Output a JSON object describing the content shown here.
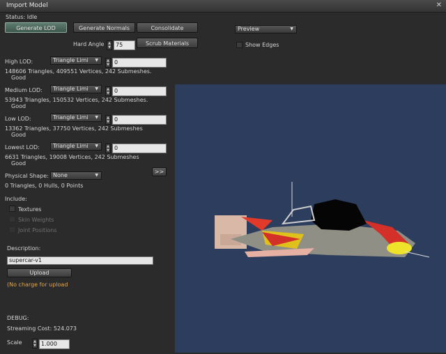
{
  "window": {
    "title": "Import Model",
    "close_label": "✕"
  },
  "status": "Status: Idle",
  "buttons": {
    "generate_lod": "Generate LOD",
    "generate_normals": "Generate Normals",
    "consolidate": "Consolidate",
    "scrub_materials": "Scrub Materials",
    "upload": "Upload",
    "expand": ">>"
  },
  "hard_angle": {
    "label": "Hard Angle",
    "value": "75"
  },
  "preview": {
    "selected": "Preview",
    "show_edges_label": "Show Edges"
  },
  "lods": [
    {
      "label": "High LOD:",
      "mode": "Triangle Limi",
      "value": "0",
      "stats": "148606 Triangles, 409551 Vertices, 242 Submeshes.",
      "quality": "Good"
    },
    {
      "label": "Medium LOD:",
      "mode": "Triangle Limi",
      "value": "0",
      "stats": "53943 Triangles, 150532 Vertices, 242 Submeshes.",
      "quality": "Good"
    },
    {
      "label": "Low LOD:",
      "mode": "Triangle Limi",
      "value": "0",
      "stats": "13362 Triangles, 37750 Vertices, 242 Submeshes",
      "quality": "Good"
    },
    {
      "label": "Lowest LOD:",
      "mode": "Triangle Limi",
      "value": "0",
      "stats": "6631 Triangles, 19008 Vertices, 242 Submeshes",
      "quality": "Good"
    }
  ],
  "physical": {
    "label": "Physical Shape:",
    "selected": "None",
    "stats": "0 Triangles, 0 Hulls, 0 Points"
  },
  "include": {
    "label": "Include:",
    "textures": "Textures",
    "skin_weights": "Skin Weights",
    "joint_positions": "Joint Positions"
  },
  "description": {
    "label": "Description:",
    "value": "supercar-v1"
  },
  "upload_note": "(No charge for upload",
  "debug": {
    "label": "DEBUG:",
    "streaming_cost": "Streaming Cost: 524.073"
  },
  "scale": {
    "label": "Scale",
    "value": "1.000"
  },
  "colors": {
    "viewport_bg": "#2c3d5e",
    "accent_green": "#5f7c70",
    "note_orange": "#e6a64a"
  }
}
